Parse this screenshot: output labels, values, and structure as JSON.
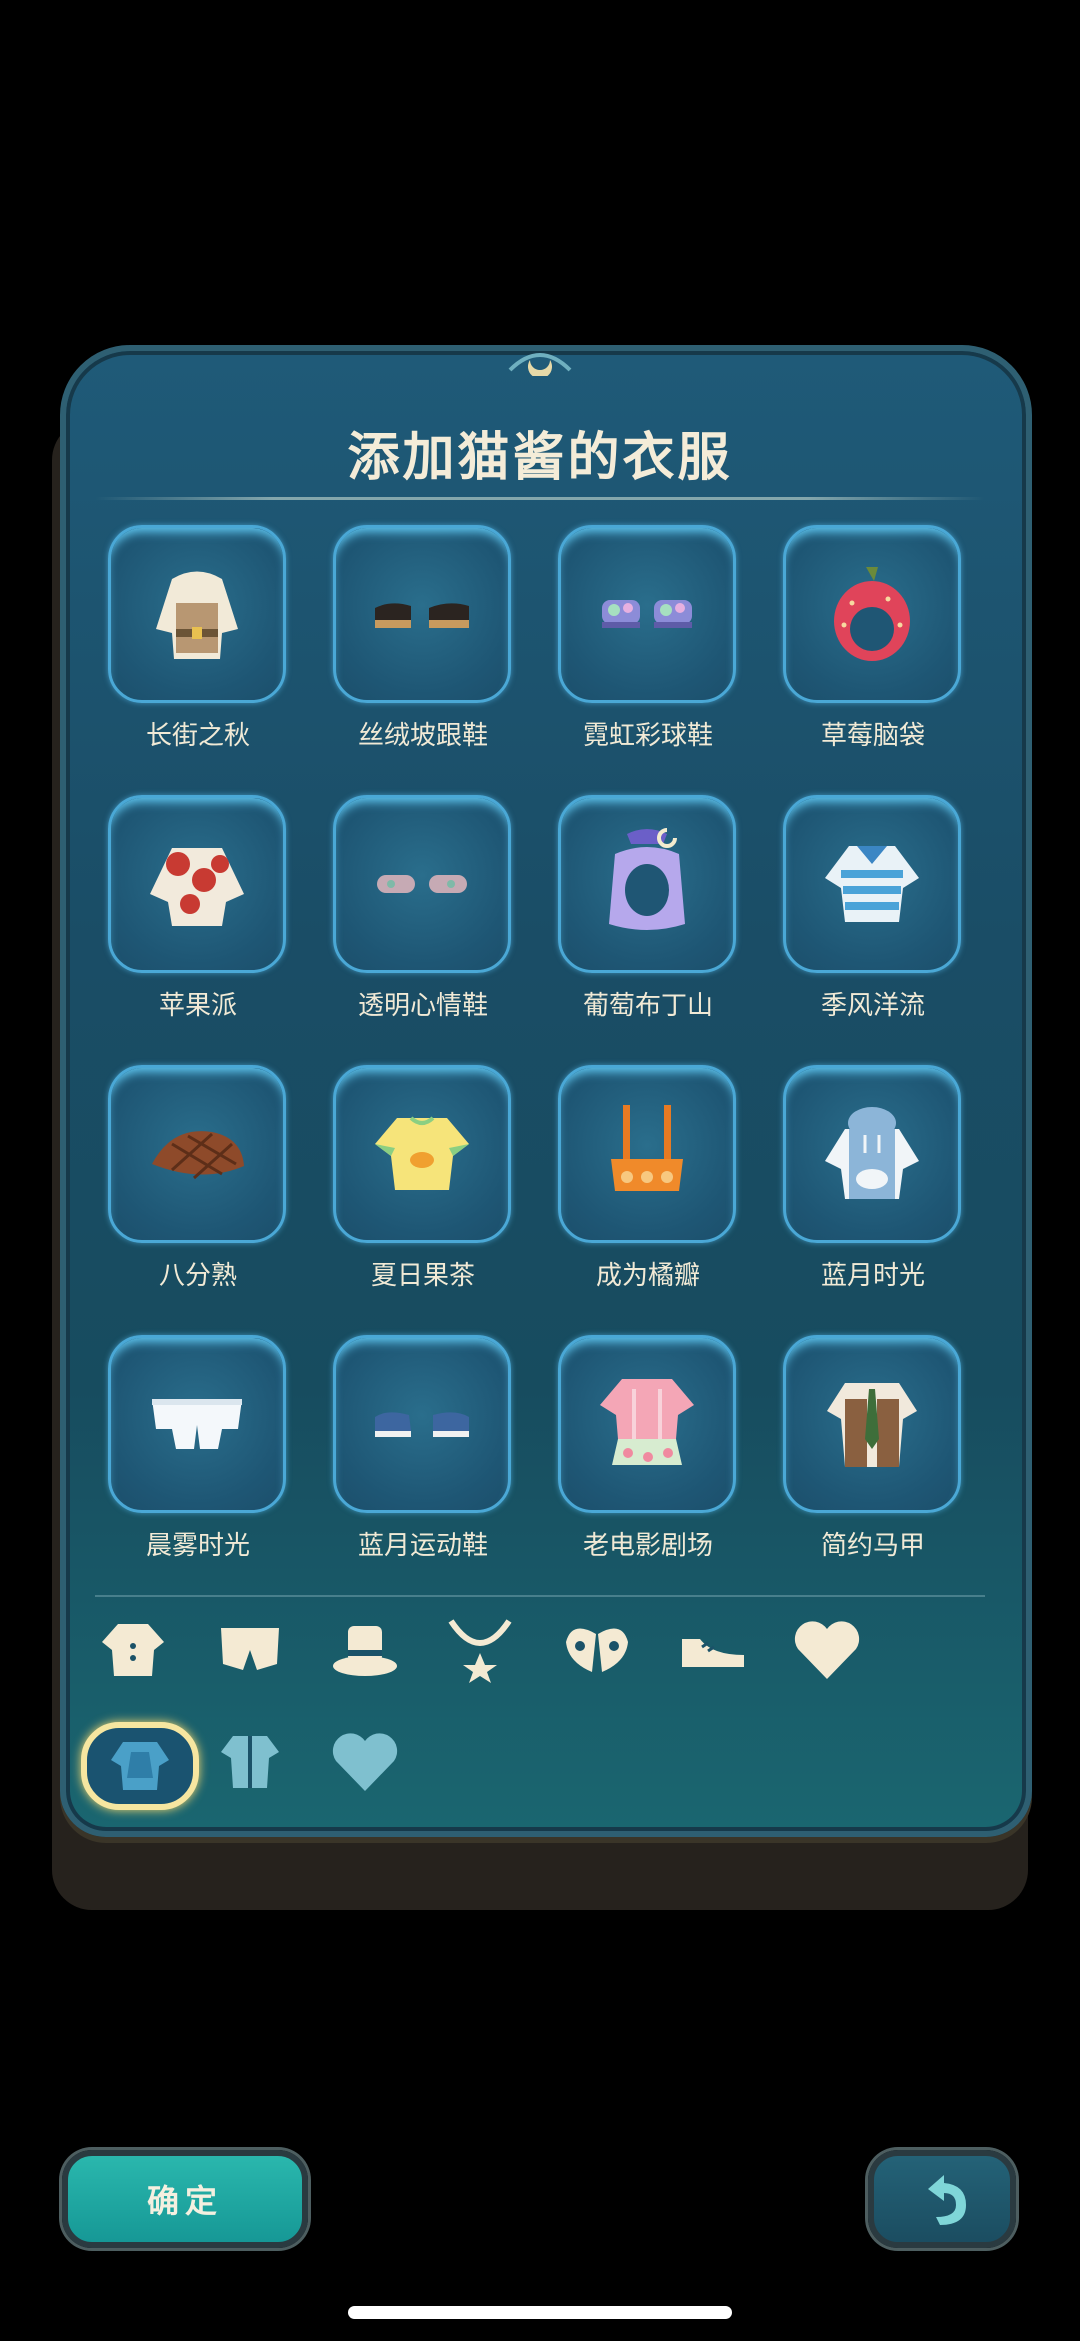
{
  "title": "添加猫酱的衣服",
  "items": [
    {
      "label": "长街之秋",
      "icon": "trench-coat-icon"
    },
    {
      "label": "丝绒坡跟鞋",
      "icon": "heeled-shoes-icon"
    },
    {
      "label": "霓虹彩球鞋",
      "icon": "neon-sneakers-icon"
    },
    {
      "label": "草莓脑袋",
      "icon": "strawberry-hat-icon"
    },
    {
      "label": "苹果派",
      "icon": "apple-pie-jacket-icon"
    },
    {
      "label": "透明心情鞋",
      "icon": "clear-shoes-icon"
    },
    {
      "label": "葡萄布丁山",
      "icon": "grape-pudding-hat-icon"
    },
    {
      "label": "季风洋流",
      "icon": "striped-sailor-shirt-icon"
    },
    {
      "label": "八分熟",
      "icon": "steak-hat-icon"
    },
    {
      "label": "夏日果茶",
      "icon": "yellow-tshirt-icon"
    },
    {
      "label": "成为橘瓣",
      "icon": "orange-overalls-icon"
    },
    {
      "label": "蓝月时光",
      "icon": "blue-hoodie-icon"
    },
    {
      "label": "晨雾时光",
      "icon": "white-shorts-icon"
    },
    {
      "label": "蓝月运动鞋",
      "icon": "blue-sneakers-icon"
    },
    {
      "label": "老电影剧场",
      "icon": "pink-dress-icon"
    },
    {
      "label": "简约马甲",
      "icon": "vest-tie-icon"
    }
  ],
  "categories": [
    "shirt-icon",
    "shorts-icon",
    "hat-icon",
    "necklace-icon",
    "wings-icon",
    "shoe-icon",
    "heart-icon"
  ],
  "sub_categories": [
    "tops-icon",
    "suit-icon",
    "heart-icon"
  ],
  "active_sub_category": 0,
  "buttons": {
    "confirm": "确定",
    "back_icon": "undo-arrow-icon"
  },
  "colors": {
    "panel": "#1a4d66",
    "slot_border": "#4aa8d6",
    "confirm": "#22aaa3",
    "active_outline": "#f6e6a0"
  }
}
